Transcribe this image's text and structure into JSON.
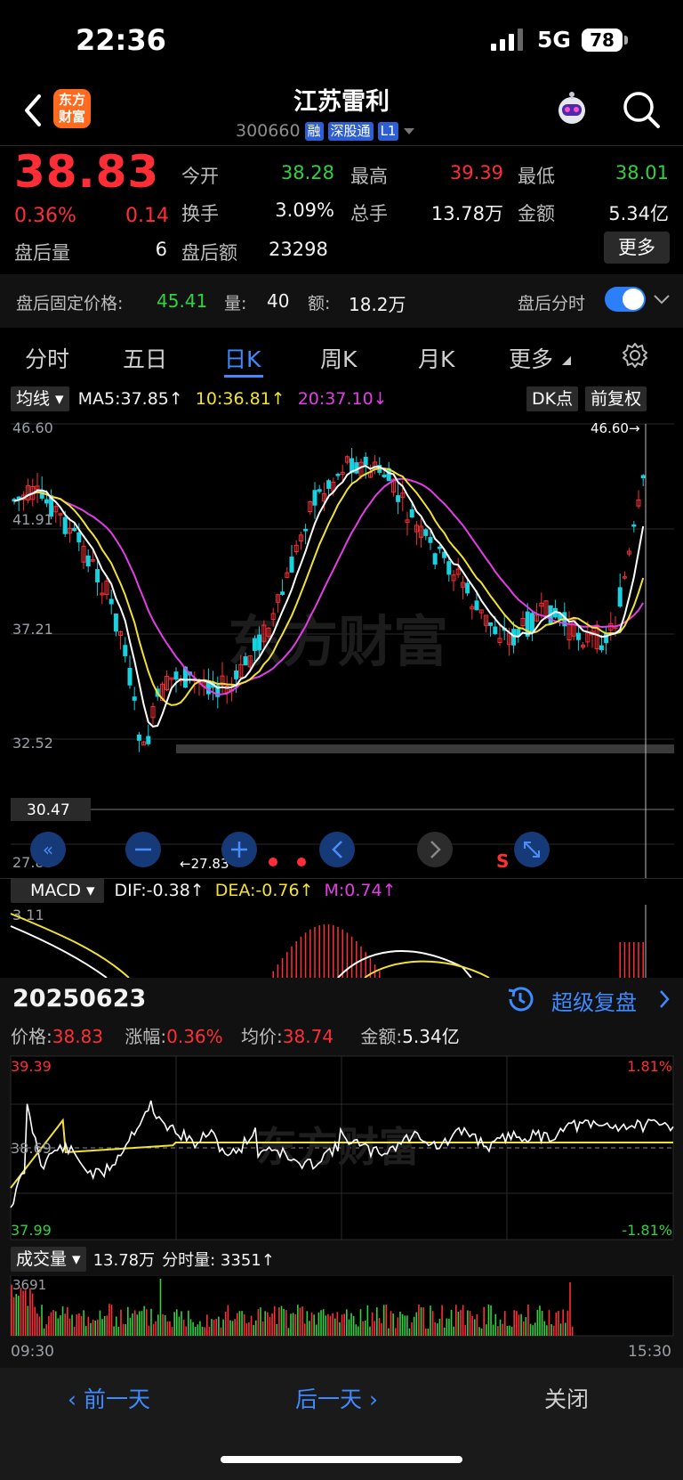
{
  "status": {
    "time": "22:36",
    "network": "5G",
    "battery": "78"
  },
  "header": {
    "logo": "东方财富",
    "title": "江苏雷利",
    "code": "300660",
    "tags": [
      "融",
      "深股通",
      "L1"
    ]
  },
  "quote": {
    "price": "38.83",
    "change_pct": "0.36%",
    "change_amt": "0.14",
    "after_hours_volume_label": "盘后量",
    "after_hours_volume": "6",
    "stats": [
      {
        "label": "今开",
        "value": "38.28",
        "color": "green"
      },
      {
        "label": "最高",
        "value": "39.39",
        "color": "red"
      },
      {
        "label": "最低",
        "value": "38.01",
        "color": "green"
      },
      {
        "label": "换手",
        "value": "3.09%",
        "color": "white"
      },
      {
        "label": "总手",
        "value": "13.78万",
        "color": "white"
      },
      {
        "label": "金额",
        "value": "5.34亿",
        "color": "white"
      },
      {
        "label": "盘后额",
        "value": "23298",
        "color": "white"
      }
    ],
    "more_label": "更多"
  },
  "after_hours": {
    "fixed_price_label": "盘后固定价格:",
    "fixed_price": "45.41",
    "vol_label": "量:",
    "vol": "40",
    "amt_label": "额:",
    "amt": "18.2万",
    "timeshare_label": "盘后分时",
    "toggle_on": true
  },
  "tabs": [
    {
      "label": "分时",
      "active": false
    },
    {
      "label": "五日",
      "active": false
    },
    {
      "label": "日K",
      "active": true
    },
    {
      "label": "周K",
      "active": false
    },
    {
      "label": "月K",
      "active": false
    },
    {
      "label": "更多",
      "active": false
    }
  ],
  "kline": {
    "indicator": "均线",
    "ma5": "MA5:37.85↑",
    "ma10": "10:36.81↑",
    "ma20": "20:37.10↓",
    "dk_label": "DK点",
    "adjust_label": "前复权",
    "y_ticks": [
      "46.60",
      "41.91",
      "37.21",
      "32.52",
      "27.83"
    ],
    "current_line": "30.47",
    "high_marker": "46.60→",
    "low_marker": "←27.83",
    "s_marker": "S",
    "watermark": "东方财富",
    "colors": {
      "up": "#ff2e36",
      "down": "#17d2e0",
      "ma5": "#ffffff",
      "ma10": "#f2e233",
      "ma20": "#e33ee6"
    }
  },
  "macd": {
    "indicator": "MACD",
    "dif": "DIF:-0.38↑",
    "dea": "DEA:-0.76↑",
    "m": "M:0.74↑",
    "top_tick": "3.11"
  },
  "replay": {
    "date": "20250623",
    "super_replay": "超级复盘",
    "price_label": "价格:",
    "price": "38.83",
    "chg_label": "涨幅:",
    "chg": "0.36%",
    "avg_label": "均价:",
    "avg": "38.74",
    "amt_label": "金额:",
    "amt": "5.34亿",
    "y_high": "39.39",
    "y_low": "37.99",
    "y_mid": "38.69",
    "pct_high": "1.81%",
    "pct_low": "-1.81%",
    "volume_label": "成交量",
    "total_vol": "13.78万",
    "timeshare_vol": "分时量: 3351↑",
    "vol_max": "3691",
    "time_start": "09:30",
    "time_end": "15:30"
  },
  "bottom": {
    "prev": "前一天",
    "next": "后一天",
    "close": "关闭"
  }
}
